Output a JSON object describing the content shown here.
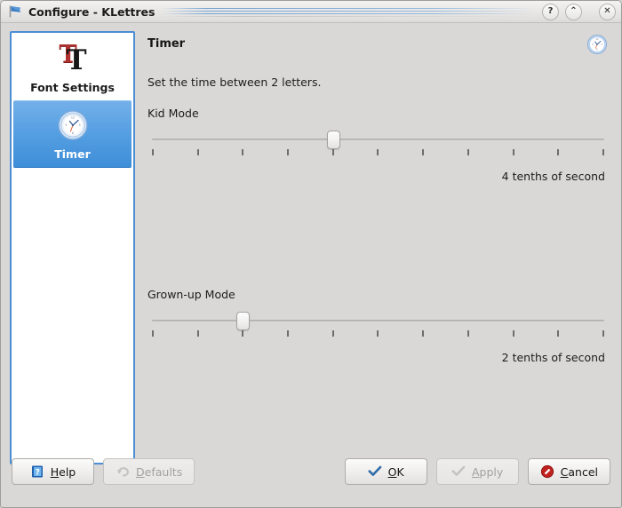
{
  "window": {
    "title": "Configure - KLettres",
    "app_icon": "flag-icon",
    "titlebar_buttons": [
      {
        "name": "help-button",
        "glyph": "?"
      },
      {
        "name": "shade-button",
        "glyph": "⌃"
      },
      {
        "name": "close-button",
        "glyph": "✕"
      }
    ]
  },
  "sidebar": {
    "items": [
      {
        "label": "Font Settings",
        "icon": "font-tt-icon",
        "selected": false
      },
      {
        "label": "Timer",
        "icon": "clock-icon",
        "selected": true
      }
    ]
  },
  "main": {
    "title": "Timer",
    "header_icon": "clock-icon",
    "description": "Set the time between 2 letters.",
    "sliders": [
      {
        "label": "Kid Mode",
        "value": 4,
        "min": 0,
        "max": 10,
        "tick_count": 11,
        "value_text": "4 tenths of second"
      },
      {
        "label": "Grown-up Mode",
        "value": 2,
        "min": 0,
        "max": 10,
        "tick_count": 11,
        "value_text": "2 tenths of second"
      }
    ]
  },
  "footer": {
    "help": {
      "label_pre": "",
      "accel": "H",
      "label_post": "elp",
      "icon": "help-book-icon",
      "enabled": true
    },
    "defaults": {
      "label_pre": "",
      "accel": "D",
      "label_post": "efaults",
      "icon": "undo-icon",
      "enabled": false
    },
    "ok": {
      "label_pre": "",
      "accel": "O",
      "label_post": "K",
      "icon": "check-icon",
      "enabled": true
    },
    "apply": {
      "label_pre": "",
      "accel": "A",
      "label_post": "pply",
      "icon": "check-icon",
      "enabled": false
    },
    "cancel": {
      "label_pre": "",
      "accel": "C",
      "label_post": "ancel",
      "icon": "stop-icon",
      "enabled": true
    }
  },
  "colors": {
    "accent_blue": "#4b8ed4",
    "selection_top": "#73b0e9",
    "selection_bottom": "#3e8ed8",
    "panel_bg": "#d9d8d6",
    "list_bg": "#ffffff",
    "cancel_red": "#c0201e",
    "ok_blue": "#2f6ba8"
  }
}
